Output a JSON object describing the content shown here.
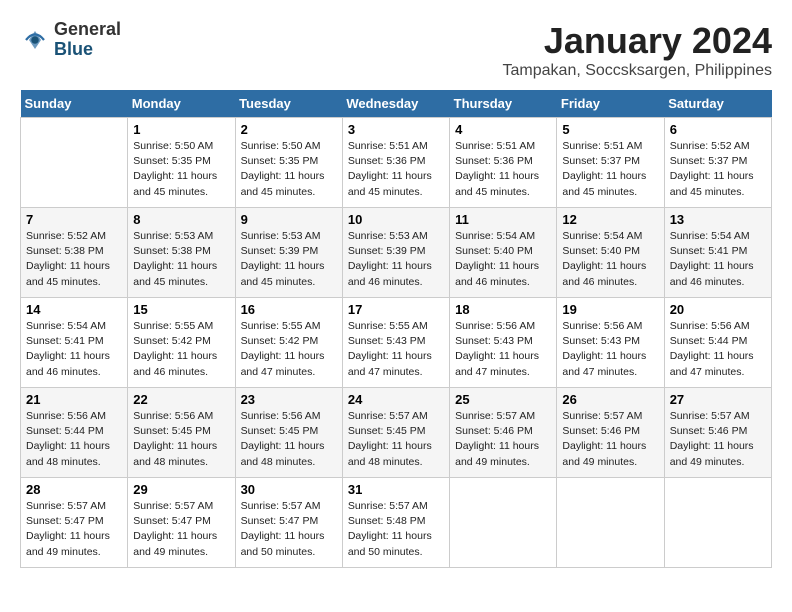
{
  "logo": {
    "general": "General",
    "blue": "Blue"
  },
  "title": "January 2024",
  "location": "Tampakan, Soccsksargen, Philippines",
  "days_of_week": [
    "Sunday",
    "Monday",
    "Tuesday",
    "Wednesday",
    "Thursday",
    "Friday",
    "Saturday"
  ],
  "weeks": [
    [
      {
        "day": "",
        "info": ""
      },
      {
        "day": "1",
        "info": "Sunrise: 5:50 AM\nSunset: 5:35 PM\nDaylight: 11 hours\nand 45 minutes."
      },
      {
        "day": "2",
        "info": "Sunrise: 5:50 AM\nSunset: 5:35 PM\nDaylight: 11 hours\nand 45 minutes."
      },
      {
        "day": "3",
        "info": "Sunrise: 5:51 AM\nSunset: 5:36 PM\nDaylight: 11 hours\nand 45 minutes."
      },
      {
        "day": "4",
        "info": "Sunrise: 5:51 AM\nSunset: 5:36 PM\nDaylight: 11 hours\nand 45 minutes."
      },
      {
        "day": "5",
        "info": "Sunrise: 5:51 AM\nSunset: 5:37 PM\nDaylight: 11 hours\nand 45 minutes."
      },
      {
        "day": "6",
        "info": "Sunrise: 5:52 AM\nSunset: 5:37 PM\nDaylight: 11 hours\nand 45 minutes."
      }
    ],
    [
      {
        "day": "7",
        "info": "Sunrise: 5:52 AM\nSunset: 5:38 PM\nDaylight: 11 hours\nand 45 minutes."
      },
      {
        "day": "8",
        "info": "Sunrise: 5:53 AM\nSunset: 5:38 PM\nDaylight: 11 hours\nand 45 minutes."
      },
      {
        "day": "9",
        "info": "Sunrise: 5:53 AM\nSunset: 5:39 PM\nDaylight: 11 hours\nand 45 minutes."
      },
      {
        "day": "10",
        "info": "Sunrise: 5:53 AM\nSunset: 5:39 PM\nDaylight: 11 hours\nand 46 minutes."
      },
      {
        "day": "11",
        "info": "Sunrise: 5:54 AM\nSunset: 5:40 PM\nDaylight: 11 hours\nand 46 minutes."
      },
      {
        "day": "12",
        "info": "Sunrise: 5:54 AM\nSunset: 5:40 PM\nDaylight: 11 hours\nand 46 minutes."
      },
      {
        "day": "13",
        "info": "Sunrise: 5:54 AM\nSunset: 5:41 PM\nDaylight: 11 hours\nand 46 minutes."
      }
    ],
    [
      {
        "day": "14",
        "info": "Sunrise: 5:54 AM\nSunset: 5:41 PM\nDaylight: 11 hours\nand 46 minutes."
      },
      {
        "day": "15",
        "info": "Sunrise: 5:55 AM\nSunset: 5:42 PM\nDaylight: 11 hours\nand 46 minutes."
      },
      {
        "day": "16",
        "info": "Sunrise: 5:55 AM\nSunset: 5:42 PM\nDaylight: 11 hours\nand 47 minutes."
      },
      {
        "day": "17",
        "info": "Sunrise: 5:55 AM\nSunset: 5:43 PM\nDaylight: 11 hours\nand 47 minutes."
      },
      {
        "day": "18",
        "info": "Sunrise: 5:56 AM\nSunset: 5:43 PM\nDaylight: 11 hours\nand 47 minutes."
      },
      {
        "day": "19",
        "info": "Sunrise: 5:56 AM\nSunset: 5:43 PM\nDaylight: 11 hours\nand 47 minutes."
      },
      {
        "day": "20",
        "info": "Sunrise: 5:56 AM\nSunset: 5:44 PM\nDaylight: 11 hours\nand 47 minutes."
      }
    ],
    [
      {
        "day": "21",
        "info": "Sunrise: 5:56 AM\nSunset: 5:44 PM\nDaylight: 11 hours\nand 48 minutes."
      },
      {
        "day": "22",
        "info": "Sunrise: 5:56 AM\nSunset: 5:45 PM\nDaylight: 11 hours\nand 48 minutes."
      },
      {
        "day": "23",
        "info": "Sunrise: 5:56 AM\nSunset: 5:45 PM\nDaylight: 11 hours\nand 48 minutes."
      },
      {
        "day": "24",
        "info": "Sunrise: 5:57 AM\nSunset: 5:45 PM\nDaylight: 11 hours\nand 48 minutes."
      },
      {
        "day": "25",
        "info": "Sunrise: 5:57 AM\nSunset: 5:46 PM\nDaylight: 11 hours\nand 49 minutes."
      },
      {
        "day": "26",
        "info": "Sunrise: 5:57 AM\nSunset: 5:46 PM\nDaylight: 11 hours\nand 49 minutes."
      },
      {
        "day": "27",
        "info": "Sunrise: 5:57 AM\nSunset: 5:46 PM\nDaylight: 11 hours\nand 49 minutes."
      }
    ],
    [
      {
        "day": "28",
        "info": "Sunrise: 5:57 AM\nSunset: 5:47 PM\nDaylight: 11 hours\nand 49 minutes."
      },
      {
        "day": "29",
        "info": "Sunrise: 5:57 AM\nSunset: 5:47 PM\nDaylight: 11 hours\nand 49 minutes."
      },
      {
        "day": "30",
        "info": "Sunrise: 5:57 AM\nSunset: 5:47 PM\nDaylight: 11 hours\nand 50 minutes."
      },
      {
        "day": "31",
        "info": "Sunrise: 5:57 AM\nSunset: 5:48 PM\nDaylight: 11 hours\nand 50 minutes."
      },
      {
        "day": "",
        "info": ""
      },
      {
        "day": "",
        "info": ""
      },
      {
        "day": "",
        "info": ""
      }
    ]
  ]
}
